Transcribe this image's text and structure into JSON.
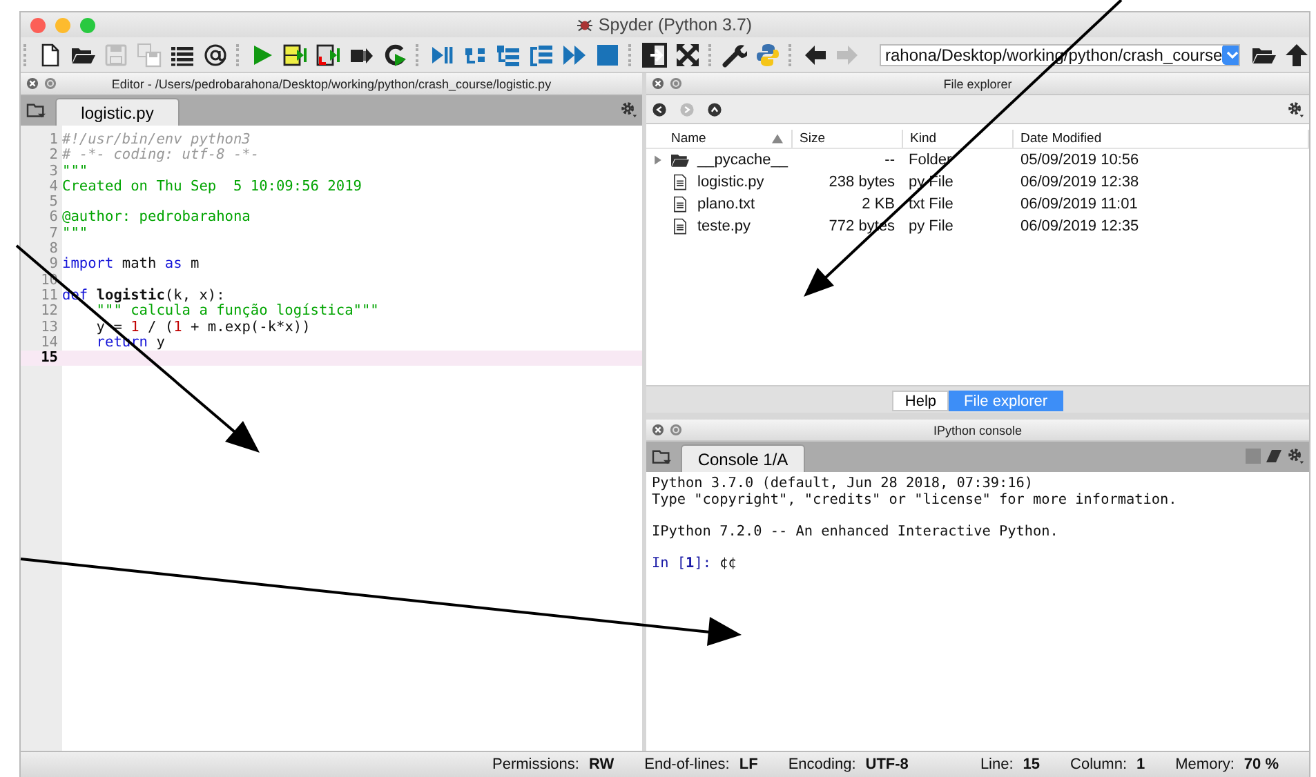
{
  "window": {
    "title": "Spyder (Python 3.7)"
  },
  "toolbar": [
    [
      {
        "kind": "new-file",
        "disabled": false
      },
      {
        "kind": "open",
        "disabled": false
      },
      {
        "kind": "save",
        "disabled": true
      },
      {
        "kind": "save-all",
        "disabled": true
      },
      {
        "kind": "list",
        "disabled": false
      },
      {
        "kind": "at",
        "disabled": false
      }
    ],
    [
      {
        "kind": "run",
        "disabled": false
      },
      {
        "kind": "run-cell",
        "disabled": false
      },
      {
        "kind": "run-cell-advance",
        "disabled": false
      },
      {
        "kind": "run-selection",
        "disabled": false
      },
      {
        "kind": "rerun",
        "disabled": false
      }
    ],
    [
      {
        "kind": "debug",
        "disabled": false
      },
      {
        "kind": "step",
        "disabled": false
      },
      {
        "kind": "step-into",
        "disabled": false
      },
      {
        "kind": "step-return",
        "disabled": false
      },
      {
        "kind": "continue",
        "disabled": false
      },
      {
        "kind": "stop",
        "disabled": false
      }
    ],
    [
      {
        "kind": "maximize",
        "disabled": false
      },
      {
        "kind": "fullscreen",
        "disabled": false
      }
    ],
    [
      {
        "kind": "wrench",
        "disabled": false
      },
      {
        "kind": "python",
        "disabled": false
      }
    ],
    [
      {
        "kind": "back",
        "disabled": false
      },
      {
        "kind": "forward",
        "disabled": true
      }
    ]
  ],
  "path_field": {
    "value": "rahona/Desktop/working/python/crash_course"
  },
  "editor": {
    "title": "Editor - /Users/pedrobarahona/Desktop/working/python/crash_course/logistic.py",
    "tabs": [
      {
        "label": "logistic.py",
        "selected": true
      }
    ],
    "lines": [
      {
        "number": "1",
        "current": false,
        "tokens": [
          {
            "kind": "comment",
            "text": "#!/usr/bin/env python3"
          }
        ]
      },
      {
        "number": "2",
        "current": false,
        "tokens": [
          {
            "kind": "comment",
            "text": "# -*- coding: utf-8 -*-"
          }
        ]
      },
      {
        "number": "3",
        "current": false,
        "tokens": [
          {
            "kind": "string",
            "text": "\"\"\""
          }
        ]
      },
      {
        "number": "4",
        "current": false,
        "tokens": [
          {
            "kind": "string",
            "text": "Created on Thu Sep  5 10:09:56 2019"
          }
        ]
      },
      {
        "number": "5",
        "current": false
      },
      {
        "number": "6",
        "current": false,
        "tokens": [
          {
            "kind": "string",
            "text": "@author: pedrobarahona"
          }
        ]
      },
      {
        "number": "7",
        "current": false,
        "tokens": [
          {
            "kind": "string",
            "text": "\"\"\""
          }
        ]
      },
      {
        "number": "8",
        "current": false
      },
      {
        "number": "9",
        "current": false,
        "tokens": [
          {
            "kind": "keyword",
            "text": "import"
          },
          {
            "kind": "plain",
            "text": " math "
          },
          {
            "kind": "keyword",
            "text": "as"
          },
          {
            "kind": "plain",
            "text": " m"
          }
        ]
      },
      {
        "number": "10",
        "current": false
      },
      {
        "number": "11",
        "current": false,
        "tokens": [
          {
            "kind": "keyword",
            "text": "def "
          },
          {
            "kind": "definition",
            "text": "logistic"
          },
          {
            "kind": "plain",
            "text": "(k, x):"
          }
        ]
      },
      {
        "number": "12",
        "current": false,
        "tokens": [
          {
            "kind": "string",
            "text": "    \"\"\" calcula a função logística\"\"\""
          }
        ]
      },
      {
        "number": "13",
        "current": false,
        "tokens": [
          {
            "kind": "plain",
            "text": "    y = "
          },
          {
            "kind": "number",
            "text": "1"
          },
          {
            "kind": "plain",
            "text": " / ("
          },
          {
            "kind": "number",
            "text": "1"
          },
          {
            "kind": "plain",
            "text": " + m.exp(-k*x))"
          }
        ]
      },
      {
        "number": "14",
        "current": false,
        "tokens": [
          {
            "kind": "keyword",
            "text": "    return"
          },
          {
            "kind": "plain",
            "text": " y"
          }
        ]
      },
      {
        "number": "15",
        "current": true
      }
    ]
  },
  "file_explorer": {
    "title": "File explorer",
    "nav": [
      {
        "kind": "back",
        "disabled": false
      },
      {
        "kind": "forward",
        "disabled": true
      },
      {
        "kind": "up",
        "disabled": false
      }
    ],
    "columns": [
      {
        "label": "Name",
        "sorted": true
      },
      {
        "label": "Size",
        "sorted": false
      },
      {
        "label": "Kind",
        "sorted": false
      },
      {
        "label": "Date Modified",
        "sorted": false
      }
    ],
    "rows": [
      {
        "kind": "folder",
        "name": "__pycache__",
        "size": "--",
        "type": "Folder",
        "modified": "05/09/2019 10:56"
      },
      {
        "kind": "file",
        "name": "logistic.py",
        "size": "238 bytes",
        "type": "py File",
        "modified": "06/09/2019 12:38"
      },
      {
        "kind": "file",
        "name": "plano.txt",
        "size": "2 KB",
        "type": "txt File",
        "modified": "06/09/2019 11:01"
      },
      {
        "kind": "file",
        "name": "teste.py",
        "size": "772 bytes",
        "type": "py File",
        "modified": "06/09/2019 12:35"
      }
    ]
  },
  "pane_tabs": [
    {
      "label": "Help",
      "selected": false
    },
    {
      "label": "File explorer",
      "selected": true
    }
  ],
  "console": {
    "title": "IPython console",
    "tabs": [
      {
        "label": "Console 1/A",
        "selected": true
      }
    ],
    "paragraphs": [
      [
        "Python 3.7.0 (default, Jun 28 2018, 07:39:16)",
        "Type \"copyright\", \"credits\" or \"license\" for more information."
      ],
      [
        "IPython 7.2.0 -- An enhanced Interactive Python."
      ]
    ],
    "prompt": {
      "label": "In [**1**]:",
      "input": "¢¢"
    }
  },
  "status_bar": [
    {
      "label": "Permissions:",
      "value": "RW"
    },
    {
      "label": "End-of-lines:",
      "value": "LF"
    },
    {
      "label": "Encoding:",
      "value": "UTF-8"
    },
    {
      "label": "Line:",
      "value": "15"
    },
    {
      "label": "Column:",
      "value": "1"
    },
    {
      "label": "Memory:",
      "value": "70 %"
    }
  ]
}
